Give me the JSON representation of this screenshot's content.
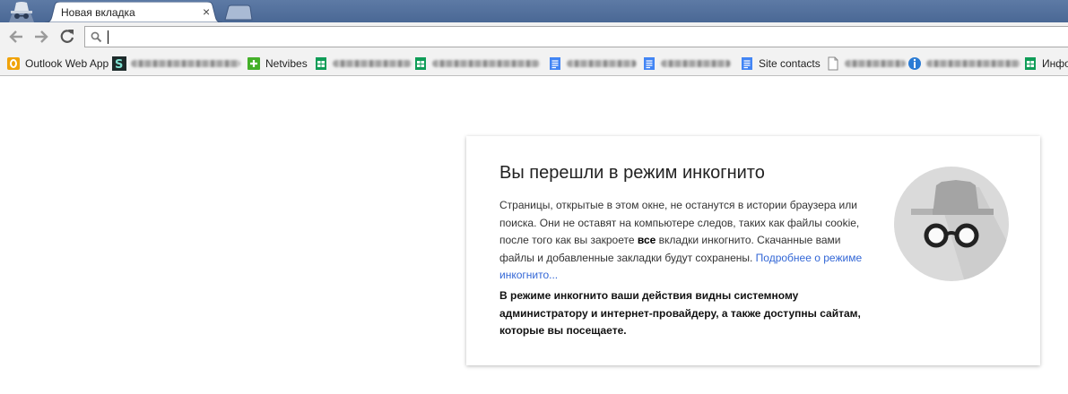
{
  "tab": {
    "title": "Новая вкладка",
    "close": "×"
  },
  "icons": {
    "incognito_logo": "incognito-icon",
    "back": "arrow-left-icon",
    "forward": "arrow-right-icon",
    "reload": "reload-icon",
    "search": "magnifier-icon",
    "close": "close-icon"
  },
  "omnibox": {
    "value": "",
    "placeholder": ""
  },
  "bookmarks": [
    {
      "label": "Outlook Web App",
      "icon": "outlook-icon",
      "obscured": false
    },
    {
      "label": "",
      "icon": "s-app-icon",
      "obscured": true
    },
    {
      "label": "Netvibes",
      "icon": "netvibes-plus-icon",
      "obscured": false
    },
    {
      "label": "",
      "icon": "sheets-icon",
      "obscured": true
    },
    {
      "label": "",
      "icon": "sheets-icon",
      "obscured": true
    },
    {
      "label": "",
      "icon": "docs-icon",
      "obscured": true
    },
    {
      "label": "",
      "icon": "docs-icon",
      "obscured": true
    },
    {
      "label": "Site contacts",
      "icon": "docs-icon",
      "obscured": false
    },
    {
      "label": "",
      "icon": "page-icon",
      "obscured": true
    },
    {
      "label": "",
      "icon": "blue-info-icon",
      "obscured": true
    },
    {
      "label": "Инфор",
      "icon": "sheets-icon",
      "obscured": false
    }
  ],
  "card": {
    "title": "Вы перешли в режим инкогнито",
    "desc_part1": "Страницы, открытые в этом окне, не останутся в истории браузера или поиска. Они не оставят на компьютере следов, таких как файлы cookie, после того как вы закроете ",
    "desc_bold": "все",
    "desc_part2": " вкладки инкогнито. Скачанные вами файлы и добавленные закладки будут сохранены. ",
    "learn_more": "Подробнее о режиме инкогнито...",
    "warning": "В режиме инкогнито ваши действия видны системному администратору и интернет-провайдеру, а также доступны сайтам, которые вы посещаете.",
    "illustration": "incognito-spy-illustration"
  },
  "colors": {
    "tabstrip": "#4a6895",
    "link": "#3367d6",
    "sheets_green": "#0f9d58",
    "docs_blue": "#4285f4",
    "netvibes_green": "#44b029",
    "outlook_orange": "#f0a30a"
  }
}
